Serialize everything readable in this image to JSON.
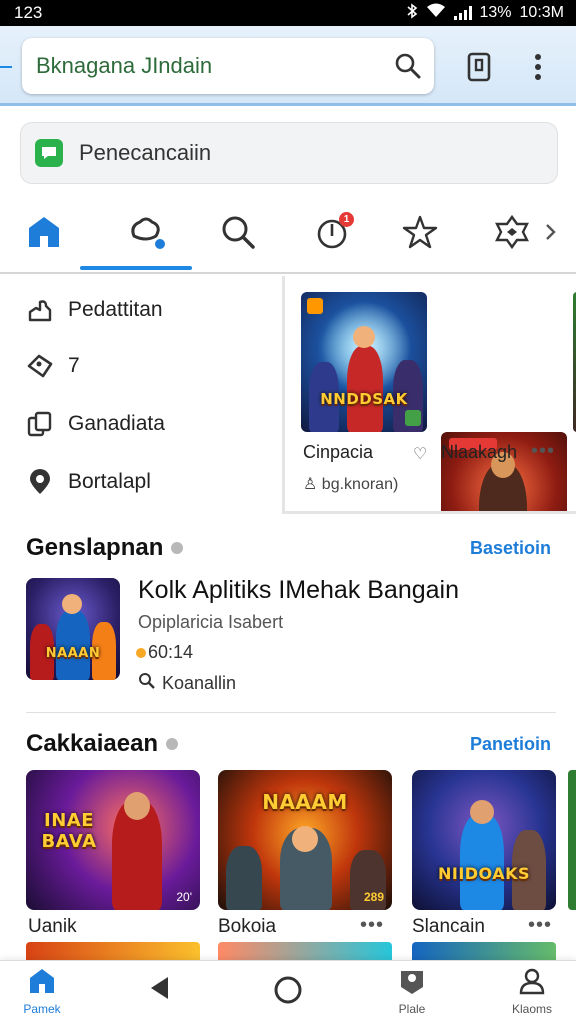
{
  "status_bar": {
    "time_left": "123",
    "battery": "13%",
    "clock": "10:3M"
  },
  "browser": {
    "url_text": "Bknagana JIndain",
    "search_icon": "search-icon",
    "tabs_icon": "tabs-icon",
    "menu_icon": "more-vert-icon"
  },
  "search": {
    "placeholder": "Penecancaiin"
  },
  "category_tabs": [
    {
      "icon": "home-icon"
    },
    {
      "icon": "apps-icon"
    },
    {
      "icon": "search-icon"
    },
    {
      "icon": "notification-icon",
      "badge": "1"
    },
    {
      "icon": "star-icon"
    },
    {
      "icon": "gamepad-icon"
    }
  ],
  "side_menu": [
    {
      "label": "Pedattitan",
      "icon": "person-icon"
    },
    {
      "label": "7",
      "icon": "tag-icon"
    },
    {
      "label": "Ganadiata",
      "icon": "copy-icon"
    },
    {
      "label": "Bortalapl",
      "icon": "location-icon"
    }
  ],
  "featured": [
    {
      "title": "Cinpacia",
      "art_text": "NNDDSAK"
    },
    {
      "title": "Nlaakagh",
      "art_text": ""
    }
  ],
  "featured_meta": "bg.knoran)",
  "section1": {
    "title": "Genslapnan",
    "link": "Basetioin"
  },
  "app": {
    "name": "Kolk Aplitiks IMehak Bangain",
    "subtitle": "Opiplaricia Isabert",
    "time": "60:14",
    "developer": "Koanallin",
    "art_text": "NAAAN"
  },
  "section2": {
    "title": "Cakkaiaean",
    "link": "Panetioin"
  },
  "grid": [
    {
      "label": "Uanik",
      "art_text": "INAE BAVA",
      "corner": "20'"
    },
    {
      "label": "Bokoia",
      "art_text": "NAAAM",
      "corner": "289"
    },
    {
      "label": "Slancain",
      "art_text": "NIIDOAKS",
      "corner": ""
    }
  ],
  "bottom_nav": [
    {
      "label": "Pamek",
      "icon": "home-icon"
    },
    {
      "label": "",
      "icon": "back-icon"
    },
    {
      "label": "",
      "icon": "circle-home-icon"
    },
    {
      "label": "Plale",
      "icon": "map-pin-icon"
    },
    {
      "label": "Klaoms",
      "icon": "profile-icon"
    }
  ],
  "colors": {
    "accent": "#1e7dd8",
    "badge": "#e53935",
    "green": "#2bb24c"
  }
}
